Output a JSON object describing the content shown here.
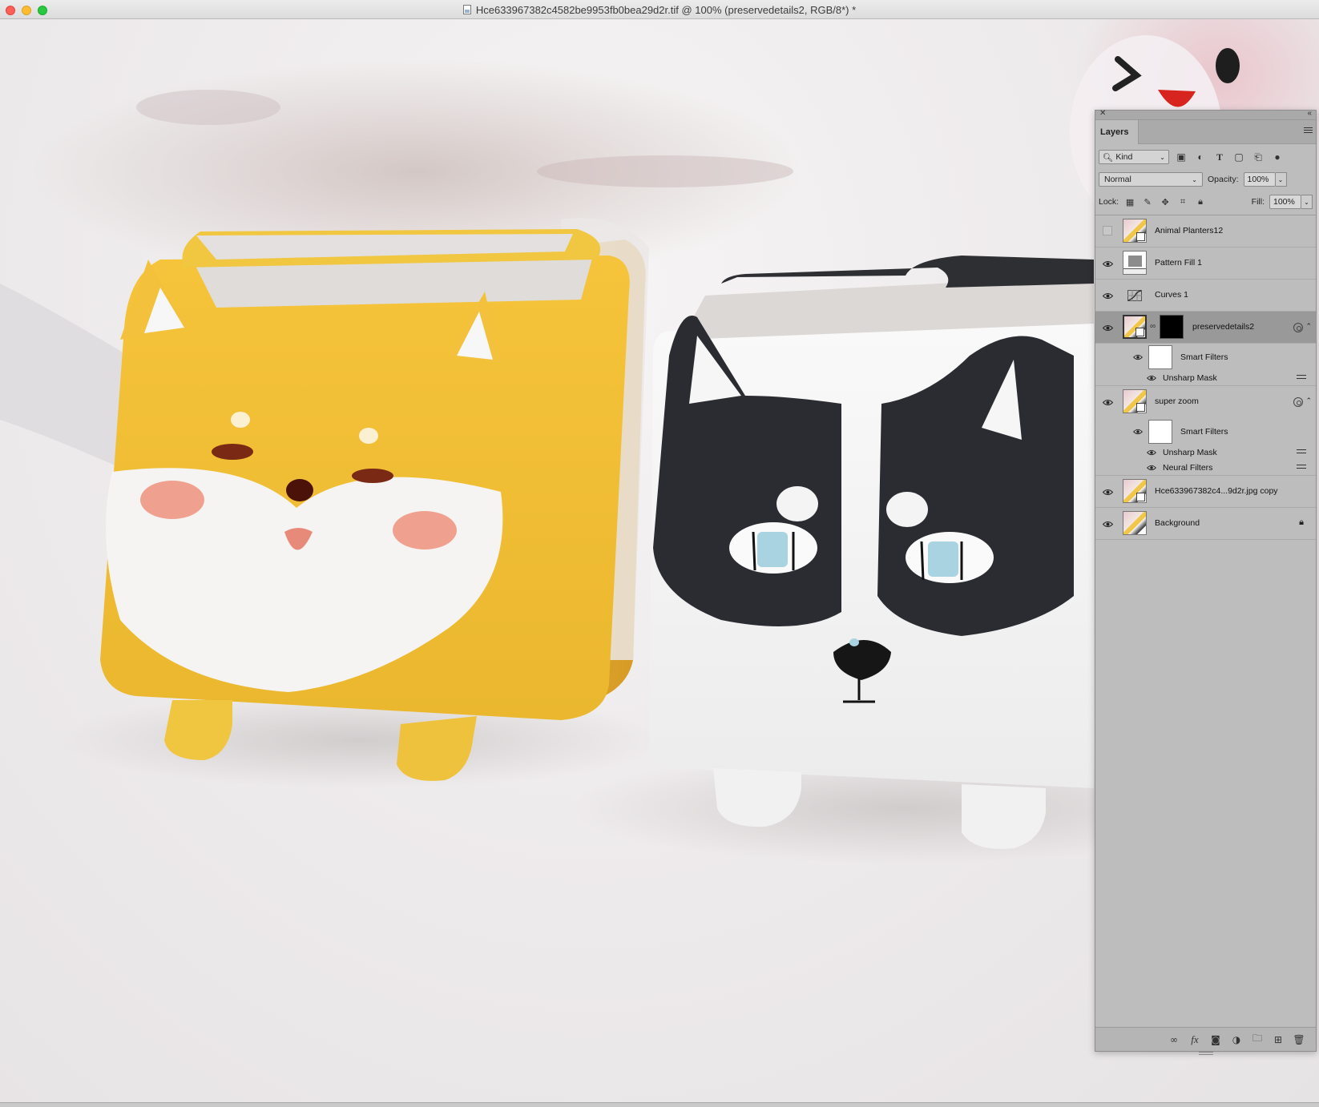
{
  "window": {
    "title": "Hce633967382c4582be9953fb0bea29d2r.tif @ 100% (preservedetails2, RGB/8*) *"
  },
  "layers_panel": {
    "tab_label": "Layers",
    "filter": {
      "kind_label": "Kind"
    },
    "blend_mode": "Normal",
    "opacity_label": "Opacity:",
    "opacity_value": "100%",
    "lock_label": "Lock:",
    "fill_label": "Fill:",
    "fill_value": "100%",
    "layers": [
      {
        "name": "Animal Planters12",
        "visible": false
      },
      {
        "name": "Pattern Fill 1",
        "visible": true
      },
      {
        "name": "Curves 1",
        "visible": true
      },
      {
        "name": "preservedetails2",
        "visible": true,
        "selected": true,
        "smart_filters_label": "Smart Filters",
        "filters": [
          "Unsharp Mask"
        ]
      },
      {
        "name": "super zoom",
        "visible": true,
        "smart_filters_label": "Smart Filters",
        "filters": [
          "Unsharp Mask",
          "Neural Filters"
        ]
      },
      {
        "name": "Hce633967382c4...9d2r.jpg copy",
        "visible": true
      },
      {
        "name": "Background",
        "visible": true,
        "locked": true
      }
    ]
  },
  "colors": {
    "panel_bg": "#bdbdbd",
    "selected_row": "#999999",
    "planter_yellow": "#f3c33c",
    "planter_black": "#2b2c31",
    "eye_blue": "#a9d3e0",
    "cheek_pink": "#f0a08e"
  }
}
